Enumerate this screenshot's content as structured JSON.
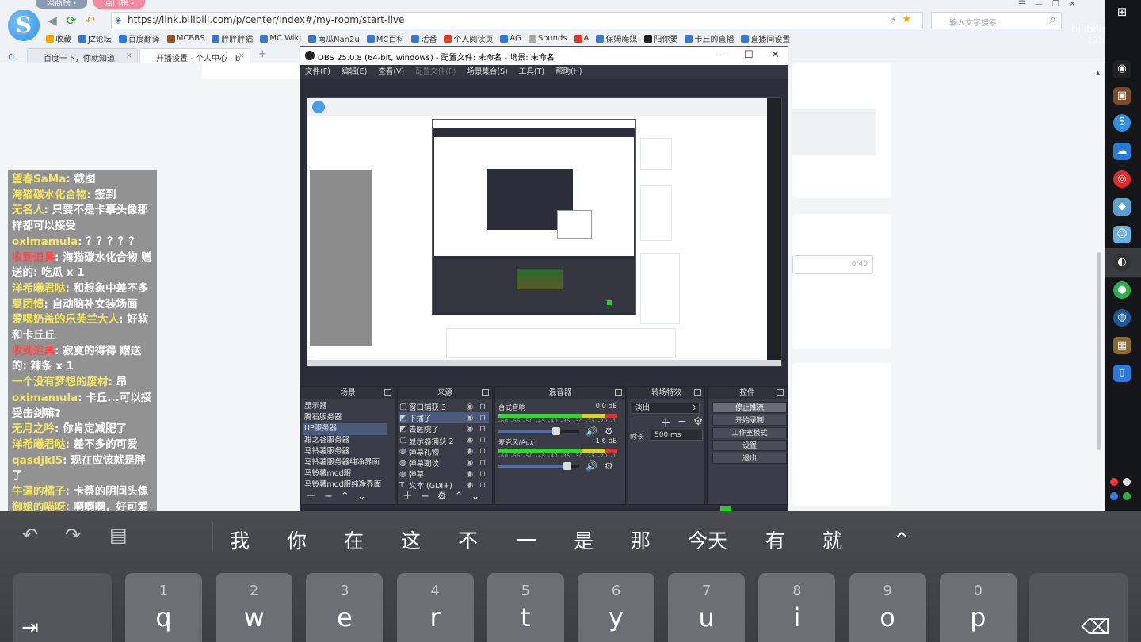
{
  "browser": {
    "pills": [
      "网商榜 ›",
      "点门榜 ›"
    ],
    "url": "https://link.bilibili.com/p/center/index#/my-room/start-live",
    "search_placeholder": "输入文字搜索",
    "watermark": "bilibili直播",
    "watermark_sub": "293873",
    "bookmarks": [
      "收藏",
      "JZ论坛",
      "百度翻译",
      "MCBBS",
      "胖胖胖猫",
      "MC Wiki",
      "南瓜Nan2u",
      "MC百科",
      "活番",
      "个人阅读页",
      "AG",
      "Sounds",
      "A",
      "保姆庵媒",
      "阳你要",
      "卡丘的直播",
      "直播间设置"
    ],
    "tabs": [
      "百度一下，你就知道",
      "开播设置 - 个人中心 - b"
    ],
    "tab_close": "×",
    "new_tab": "+"
  },
  "chat": {
    "messages": [
      {
        "user": "望春SaMa",
        "text": "截图",
        "sys": false
      },
      {
        "user": "海猫碳水化合物",
        "text": "签到",
        "sys": false
      },
      {
        "user": "无名人",
        "text": "只要不是卡摹头像那样都可以接受",
        "sys": false
      },
      {
        "user": "oximamula",
        "text": "？？？？？",
        "sys": false
      },
      {
        "user": "收到道具",
        "text": "海猫碳水化合物 赠送的: 吃瓜 x 1",
        "sys": true
      },
      {
        "user": "洋希曦君哒",
        "text": "和想象中差不多",
        "sys": false
      },
      {
        "user": "夏团惯",
        "text": "自动脑补女装场面",
        "sys": false
      },
      {
        "user": "爱喝奶盖的乐芙兰大人",
        "text": "好软和卡丘丘",
        "sys": false
      },
      {
        "user": "收到道具",
        "text": "寂寞的得得 赠送的: 辣条 x 1",
        "sys": true
      },
      {
        "user": "一个没有梦想的废材",
        "text": "昂",
        "sys": false
      },
      {
        "user": "oximamula",
        "text": "卡丘...可以接受击剑嘛?",
        "sys": false
      },
      {
        "user": "无月之吟",
        "text": "你肯定减肥了",
        "sys": false
      },
      {
        "user": "洋希曦君哒",
        "text": "差不多的可爱",
        "sys": false
      },
      {
        "user": "qasdjkl5",
        "text": "现在应该就是胖了",
        "sys": false
      },
      {
        "user": "牛逼的橘子",
        "text": "卡蔡的阴间头像",
        "sys": false
      },
      {
        "user": "御姐的喵呀",
        "text": "啊啊啊，好可爱",
        "sys": false
      }
    ]
  },
  "obs": {
    "title": "OBS 25.0.8 (64-bit, windows) - 配置文件: 未命名 - 场景: 未命名",
    "menu": [
      "文件(F)",
      "编辑(E)",
      "查看(V)",
      "配置文件(P)",
      "场景集合(S)",
      "工具(T)",
      "帮助(H)"
    ],
    "win_min": "—",
    "win_max": "☐",
    "win_close": "✕",
    "scenes_title": "场景",
    "scenes": [
      "显示器",
      "腾石服务器",
      "UP服务器",
      "甜之谷服务器",
      "马铃薯服务器",
      "马铃薯服务器纯净界面",
      "马铃薯mod服",
      "马铃薯mod服纯净界面"
    ],
    "sources_title": "来源",
    "sources": [
      {
        "icon": "▢",
        "name": "窗口捕获 3"
      },
      {
        "icon": "◩",
        "name": "下播了"
      },
      {
        "icon": "◩",
        "name": "去医院了"
      },
      {
        "icon": "▢",
        "name": "显示器捕获 2"
      },
      {
        "icon": "◍",
        "name": "弹幕礼物"
      },
      {
        "icon": "◍",
        "name": "弹幕朗读"
      },
      {
        "icon": "◍",
        "name": "弹幕"
      },
      {
        "icon": "T",
        "name": "文本 (GDI+)"
      }
    ],
    "mixer_title": "混音器",
    "mixer": [
      {
        "name": "台式音响",
        "db": "0.0 dB",
        "level": 0.72
      },
      {
        "name": "麦克风/Aux",
        "db": "-1.6 dB",
        "level": 0.85
      }
    ],
    "mixer_ticks": "-60 -55 -50 -45 -40 -35 -30 -25 -20 -15 -10 -5 0",
    "transitions_title": "转场特效",
    "transition": "淡出",
    "duration_label": "时长",
    "duration": "500 ms",
    "controls_title": "控件",
    "controls": [
      "停止推流",
      "开始录制",
      "工作室模式",
      "设置",
      "退出"
    ]
  },
  "keyboard": {
    "suggestions": [
      "我",
      "你",
      "在",
      "这",
      "不",
      "一",
      "是",
      "那",
      "今天",
      "有",
      "就"
    ],
    "keys": [
      {
        "num": "1",
        "letter": "q"
      },
      {
        "num": "2",
        "letter": "w"
      },
      {
        "num": "3",
        "letter": "e"
      },
      {
        "num": "4",
        "letter": "r"
      },
      {
        "num": "5",
        "letter": "t"
      },
      {
        "num": "6",
        "letter": "y"
      },
      {
        "num": "7",
        "letter": "u"
      },
      {
        "num": "8",
        "letter": "i"
      },
      {
        "num": "9",
        "letter": "o"
      },
      {
        "num": "0",
        "letter": "p"
      }
    ],
    "tab_symbol": "⇥",
    "delete_symbol": "⌫",
    "undo_symbol": "↶",
    "redo_symbol": "↷",
    "clipboard_symbol": "▤",
    "collapse_symbol": "^"
  },
  "colors": {
    "chat_user": "#f5e663",
    "chat_system": "#ff4a4a",
    "obs_bg": "#2b2e38",
    "keyboard_bg": "#4a4b50"
  }
}
